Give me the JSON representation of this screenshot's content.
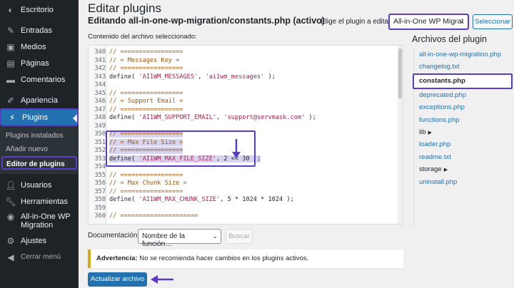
{
  "sidebar": {
    "items": [
      {
        "label": "Escritorio",
        "icon": "dashboard-icon"
      },
      {
        "label": "Entradas",
        "icon": "pin-icon"
      },
      {
        "label": "Medios",
        "icon": "media-icon"
      },
      {
        "label": "Páginas",
        "icon": "page-icon"
      },
      {
        "label": "Comentarios",
        "icon": "comment-icon"
      },
      {
        "label": "Apariencia",
        "icon": "brush-icon"
      },
      {
        "label": "Plugins",
        "icon": "plugin-icon"
      }
    ],
    "submenu": [
      {
        "label": "Plugins instalados"
      },
      {
        "label": "Añadir nuevo"
      },
      {
        "label": "Editor de plugins"
      }
    ],
    "items_after": [
      {
        "label": "Usuarios",
        "icon": "user-icon"
      },
      {
        "label": "Herramientas",
        "icon": "wrench-icon"
      },
      {
        "label": "All-in-One WP",
        "label2": "Migration",
        "icon": "migration-icon"
      },
      {
        "label": "Ajustes",
        "icon": "settings-icon"
      },
      {
        "label": "Cerrar menú",
        "icon": "collapse-icon"
      }
    ]
  },
  "header": {
    "title": "Editar plugins",
    "file_title": "Editando all-in-one-wp-migration/constants.php (activo)",
    "choose_label": "Elige el plugin a editar:",
    "plugin_selected": "All-in-One WP Migrat",
    "select_button": "Seleccionar"
  },
  "editor": {
    "label": "Contenido del archivo seleccionado:",
    "lines": [
      {
        "n": "340",
        "t": "// ================="
      },
      {
        "n": "341",
        "t": "// = Messages Key ="
      },
      {
        "n": "342",
        "t": "// ================="
      },
      {
        "n": "343",
        "t": "define( 'AI1WM_MESSAGES', 'ai1wm_messages' );"
      },
      {
        "n": "344",
        "t": ""
      },
      {
        "n": "345",
        "t": "// ================="
      },
      {
        "n": "346",
        "t": "// = Support Email ="
      },
      {
        "n": "347",
        "t": "// ================="
      },
      {
        "n": "348",
        "t": "define( 'AI1WM_SUPPORT_EMAIL', 'support@servmask.com' );"
      },
      {
        "n": "349",
        "t": ""
      },
      {
        "n": "350",
        "t": "// ================="
      },
      {
        "n": "351",
        "t": "// = Max File Size ="
      },
      {
        "n": "352",
        "t": "// ================="
      },
      {
        "n": "353",
        "t": "define( 'AI1WM_MAX_FILE_SIZE', 2 << 30 );"
      },
      {
        "n": "354",
        "t": ""
      },
      {
        "n": "355",
        "t": "// ================="
      },
      {
        "n": "356",
        "t": "// = Max Chunk Size ="
      },
      {
        "n": "357",
        "t": "// ================="
      },
      {
        "n": "358",
        "t": "define( 'AI1WM_MAX_CHUNK_SIZE', 5 * 1024 * 1024 );"
      },
      {
        "n": "359",
        "t": ""
      },
      {
        "n": "360",
        "t": "// ====================="
      }
    ]
  },
  "files": {
    "heading": "Archivos del plugin",
    "items": [
      {
        "name": "all-in-one-wp-migration.php"
      },
      {
        "name": "changelog.txt"
      },
      {
        "name": "constants.php"
      },
      {
        "name": "deprecated.php"
      },
      {
        "name": "exceptions.php"
      },
      {
        "name": "functions.php"
      },
      {
        "name": "lib"
      },
      {
        "name": "loader.php"
      },
      {
        "name": "readme.txt"
      },
      {
        "name": "storage"
      },
      {
        "name": "uninstall.php"
      }
    ]
  },
  "documentation": {
    "label": "Documentación:",
    "select_value": "Nombre de la función…",
    "search_button": "Buscar"
  },
  "notice": {
    "strong": "Advertencia:",
    "text": " No se recomienda hacer cambios en los plugins activos."
  },
  "update_button": "Actualizar archivo",
  "colors": {
    "accent": "#2271b1",
    "highlight": "#5b3cc4",
    "sidebar_bg": "#1d2327",
    "warning": "#dba617"
  }
}
